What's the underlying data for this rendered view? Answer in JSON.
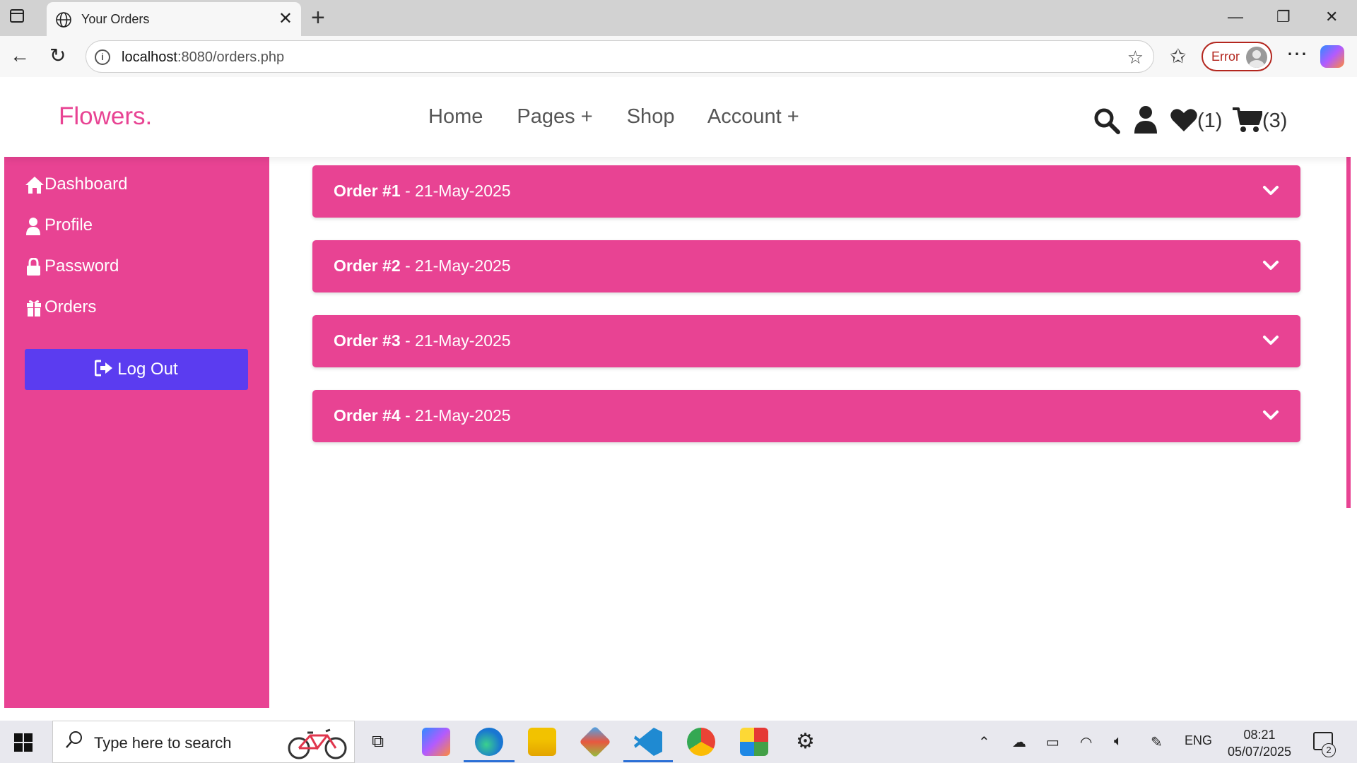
{
  "browser": {
    "tab_title": "Your Orders",
    "url_host": "localhost",
    "url_path": ":8080/orders.php",
    "profile_status": "Error"
  },
  "site": {
    "logo": "Flowers.",
    "nav": [
      "Home",
      "Pages +",
      "Shop",
      "Account +"
    ],
    "wishlist_count": "(1)",
    "cart_count": "(3)",
    "accent_color": "#e84393",
    "logout_color": "#5b3cf0"
  },
  "sidebar": {
    "items": [
      {
        "label": "Dashboard",
        "icon": "home-icon"
      },
      {
        "label": "Profile",
        "icon": "user-icon"
      },
      {
        "label": "Password",
        "icon": "lock-icon"
      },
      {
        "label": "Orders",
        "icon": "gift-icon"
      }
    ],
    "logout_label": "Log Out"
  },
  "orders": [
    {
      "id": "Order #1",
      "date": " - 21-May-2025"
    },
    {
      "id": "Order #2",
      "date": " - 21-May-2025"
    },
    {
      "id": "Order #3",
      "date": " - 21-May-2025"
    },
    {
      "id": "Order #4",
      "date": " - 21-May-2025"
    }
  ],
  "taskbar": {
    "search_placeholder": "Type here to search",
    "language": "ENG",
    "time": "08:21",
    "date": "05/07/2025",
    "notification_count": "2"
  }
}
